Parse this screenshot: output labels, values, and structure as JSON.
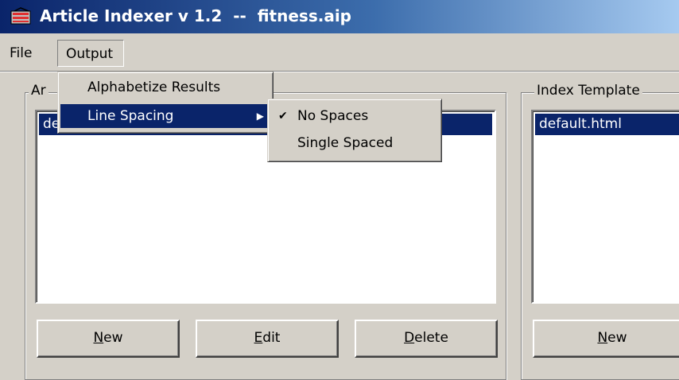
{
  "window": {
    "title": "Article Indexer v 1.2  --  fitness.aip",
    "icon": "app-icon"
  },
  "menubar": {
    "file": "File",
    "output": "Output"
  },
  "output_menu": {
    "items": [
      "Alphabetize Results",
      "Line Spacing"
    ],
    "highlighted": "Line Spacing",
    "submenu_arrow": "▶"
  },
  "line_spacing_submenu": {
    "items": [
      "No Spaces",
      "Single Spaced"
    ],
    "checked": "No Spaces",
    "check_glyph": "✔"
  },
  "articles_group": {
    "label": "Ar",
    "selected_row": "de",
    "buttons": {
      "new": {
        "mnemonic": "N",
        "rest": "ew"
      },
      "edit": {
        "mnemonic": "E",
        "rest": "dit"
      },
      "delete": {
        "mnemonic": "D",
        "rest": "elete"
      }
    }
  },
  "template_group": {
    "label": "Index Template",
    "selected_row": "default.html",
    "buttons": {
      "new": {
        "mnemonic": "N",
        "rest": "ew"
      }
    }
  },
  "colors": {
    "selection": "#0a246a",
    "face": "#d4d0c8",
    "title_start": "#0a246a",
    "title_end": "#a6caf0"
  }
}
